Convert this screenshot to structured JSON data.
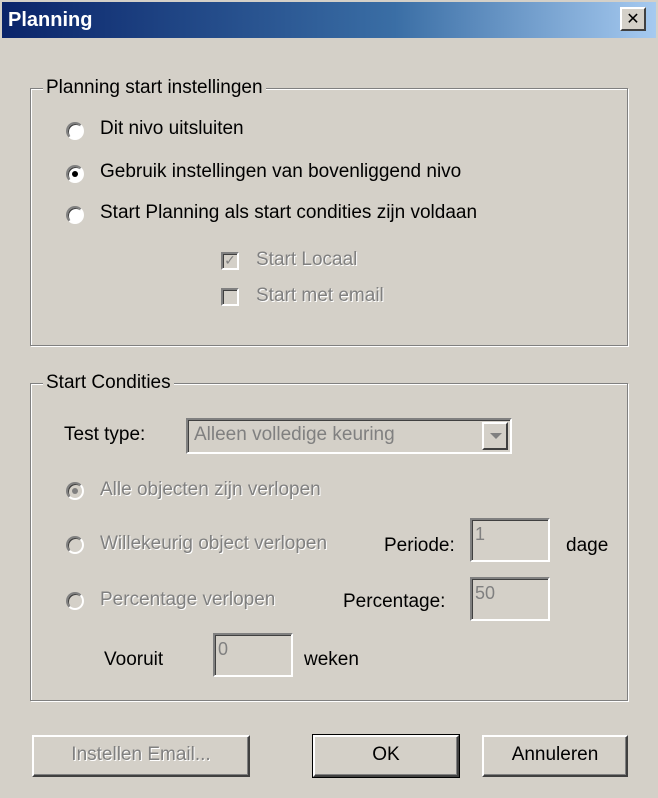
{
  "window": {
    "title": "Planning",
    "close_label": "✕"
  },
  "planning_group": {
    "legend": "Planning start instellingen",
    "options": [
      {
        "label": "Dit nivo uitsluiten",
        "selected": false
      },
      {
        "label": "Gebruik instellingen van bovenliggend nivo",
        "selected": true
      },
      {
        "label": "Start Planning als start condities zijn voldaan",
        "selected": false
      }
    ],
    "checkboxes": [
      {
        "label": "Start Locaal",
        "checked": true,
        "mark": "✓"
      },
      {
        "label": "Start met email",
        "checked": false,
        "mark": ""
      }
    ]
  },
  "conditions_group": {
    "legend": "Start Condities",
    "test_type_label": "Test type:",
    "test_type_value": "Alleen volledige keuring",
    "options": [
      {
        "label": "Alle objecten zijn verlopen",
        "selected": true
      },
      {
        "label": "Willekeurig object verlopen",
        "selected": false
      },
      {
        "label": "Percentage verlopen",
        "selected": false
      }
    ],
    "periode_label": "Periode:",
    "periode_value": "1",
    "periode_unit": "dage",
    "percentage_label": "Percentage:",
    "percentage_value": "50",
    "vooruit_label": "Vooruit",
    "vooruit_value": "0",
    "vooruit_unit": "weken"
  },
  "buttons": {
    "email": "Instellen Email...",
    "ok": "OK",
    "cancel": "Annuleren"
  }
}
